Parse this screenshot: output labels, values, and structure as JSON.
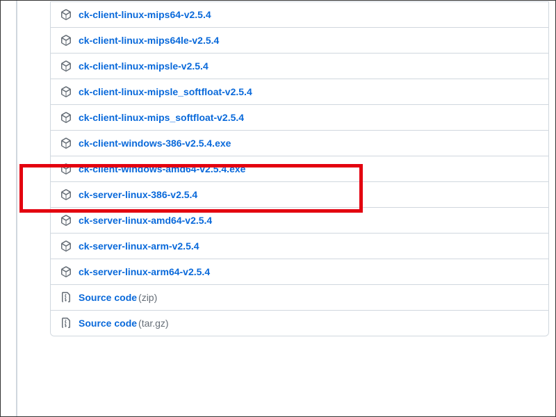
{
  "assets": [
    {
      "type": "package",
      "name": "ck-client-linux-mips64-v2.5.4"
    },
    {
      "type": "package",
      "name": "ck-client-linux-mips64le-v2.5.4"
    },
    {
      "type": "package",
      "name": "ck-client-linux-mipsle-v2.5.4"
    },
    {
      "type": "package",
      "name": "ck-client-linux-mipsle_softfloat-v2.5.4"
    },
    {
      "type": "package",
      "name": "ck-client-linux-mips_softfloat-v2.5.4"
    },
    {
      "type": "package",
      "name": "ck-client-windows-386-v2.5.4.exe"
    },
    {
      "type": "package",
      "name": "ck-client-windows-amd64-v2.5.4.exe"
    },
    {
      "type": "package",
      "name": "ck-server-linux-386-v2.5.4"
    },
    {
      "type": "package",
      "name": "ck-server-linux-amd64-v2.5.4"
    },
    {
      "type": "package",
      "name": "ck-server-linux-arm-v2.5.4"
    },
    {
      "type": "package",
      "name": "ck-server-linux-arm64-v2.5.4"
    },
    {
      "type": "zip",
      "name": "Source code",
      "suffix": "(zip)"
    },
    {
      "type": "zip",
      "name": "Source code",
      "suffix": "(tar.gz)"
    }
  ],
  "highlighted_index": 6
}
